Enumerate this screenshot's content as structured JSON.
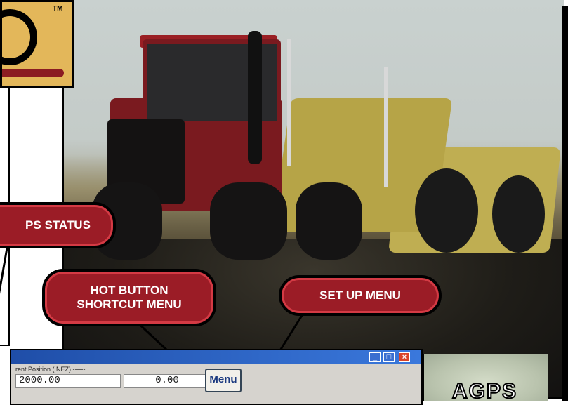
{
  "logo": {
    "tm": "TM"
  },
  "callouts": {
    "gps_status": "PS STATUS",
    "hot_button_line1": "HOT BUTTON",
    "hot_button_line2": "SHORTCUT MENU",
    "set_up_menu": "SET UP MENU"
  },
  "window": {
    "minimize": "_",
    "maximize": "□",
    "close": "×",
    "position_label": "rent Position ( NEZ) ------",
    "field1": "  2000.00",
    "field2": "0.00",
    "menu_button": "Menu"
  },
  "brand": {
    "text": "AGPS"
  },
  "colors": {
    "pill_red": "#9b1c26",
    "logo_gold": "#e3b75a",
    "titlebar_blue": "#1f4ea8"
  }
}
